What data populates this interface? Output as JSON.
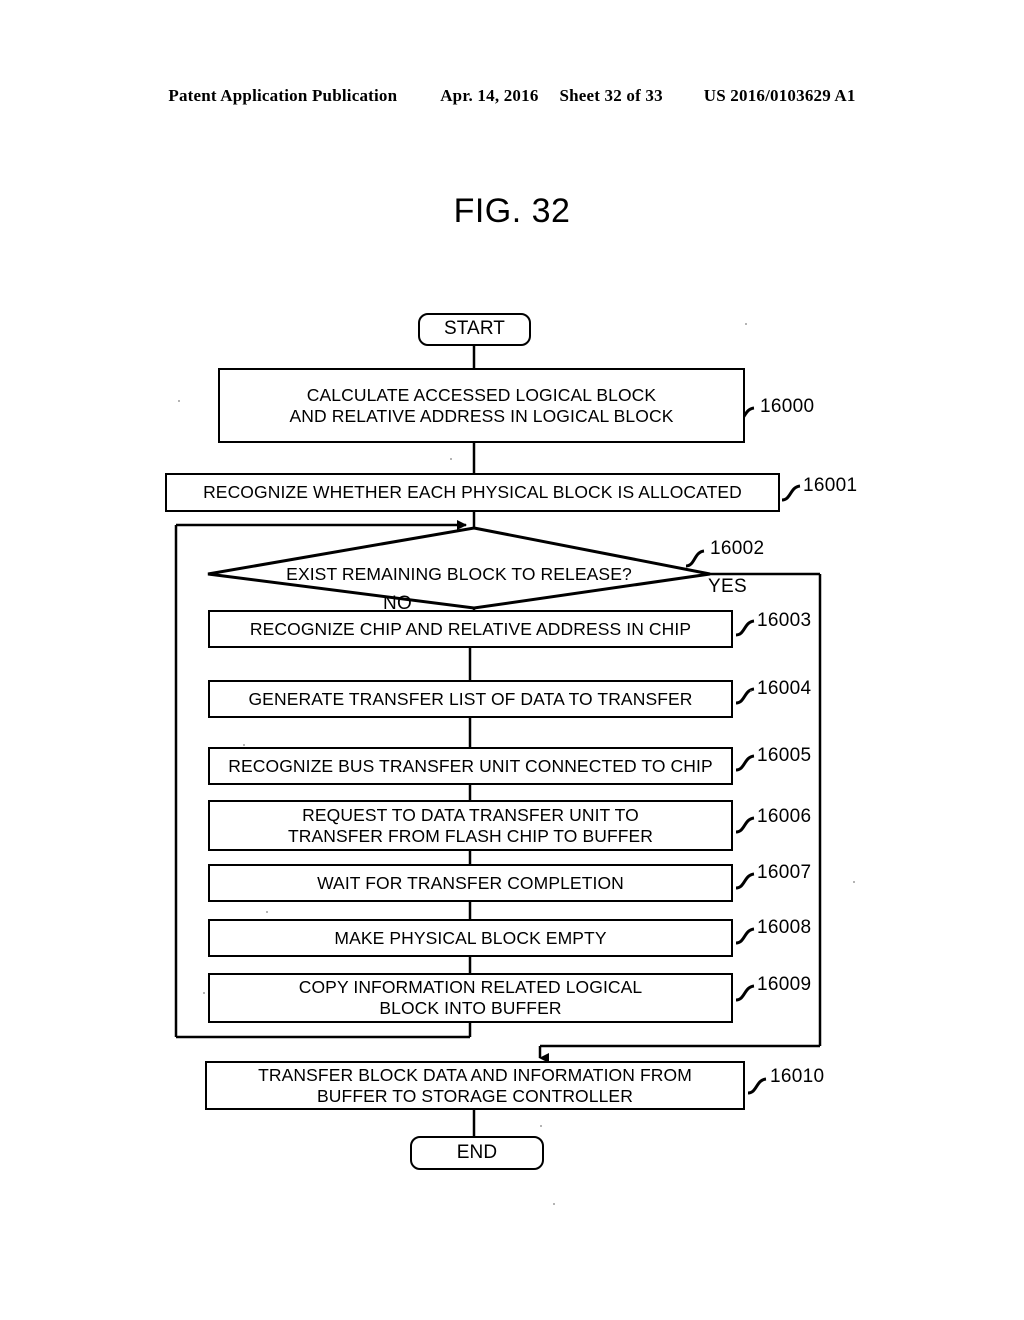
{
  "header": {
    "publication": "Patent Application Publication",
    "date": "Apr. 14, 2016",
    "sheet": "Sheet 32 of 33",
    "docnum": "US 2016/0103629 A1"
  },
  "figure": {
    "title": "FIG. 32"
  },
  "flowchart": {
    "type": "flowchart",
    "start_label": "START",
    "end_label": "END",
    "branch_yes": "YES",
    "branch_no": "NO",
    "nodes": [
      {
        "id": "start",
        "shape": "terminal",
        "text": "START",
        "ref": ""
      },
      {
        "id": "s16000",
        "shape": "process",
        "text": "CALCULATE ACCESSED LOGICAL BLOCK\nAND RELATIVE ADDRESS IN LOGICAL BLOCK",
        "ref": "16000"
      },
      {
        "id": "s16001",
        "shape": "process",
        "text": "RECOGNIZE WHETHER EACH PHYSICAL BLOCK IS ALLOCATED",
        "ref": "16001"
      },
      {
        "id": "s16002",
        "shape": "decision",
        "text": "EXIST REMAINING BLOCK TO RELEASE?",
        "ref": "16002"
      },
      {
        "id": "s16003",
        "shape": "process",
        "text": "RECOGNIZE CHIP AND RELATIVE ADDRESS IN CHIP",
        "ref": "16003"
      },
      {
        "id": "s16004",
        "shape": "process",
        "text": "GENERATE TRANSFER LIST OF DATA TO TRANSFER",
        "ref": "16004"
      },
      {
        "id": "s16005",
        "shape": "process",
        "text": "RECOGNIZE BUS TRANSFER UNIT CONNECTED TO CHIP",
        "ref": "16005"
      },
      {
        "id": "s16006",
        "shape": "process",
        "text": "REQUEST TO DATA TRANSFER UNIT TO\nTRANSFER FROM   FLASH CHIP TO BUFFER",
        "ref": "16006"
      },
      {
        "id": "s16007",
        "shape": "process",
        "text": "WAIT FOR TRANSFER COMPLETION",
        "ref": "16007"
      },
      {
        "id": "s16008",
        "shape": "process",
        "text": "MAKE PHYSICAL BLOCK EMPTY",
        "ref": "16008"
      },
      {
        "id": "s16009",
        "shape": "process",
        "text": "COPY INFORMATION RELATED LOGICAL\nBLOCK INTO BUFFER",
        "ref": "16009"
      },
      {
        "id": "s16010",
        "shape": "process",
        "text": "TRANSFER BLOCK DATA AND INFORMATION FROM\nBUFFER TO STORAGE CONTROLLER",
        "ref": "16010"
      },
      {
        "id": "end",
        "shape": "terminal",
        "text": "END",
        "ref": ""
      }
    ]
  }
}
